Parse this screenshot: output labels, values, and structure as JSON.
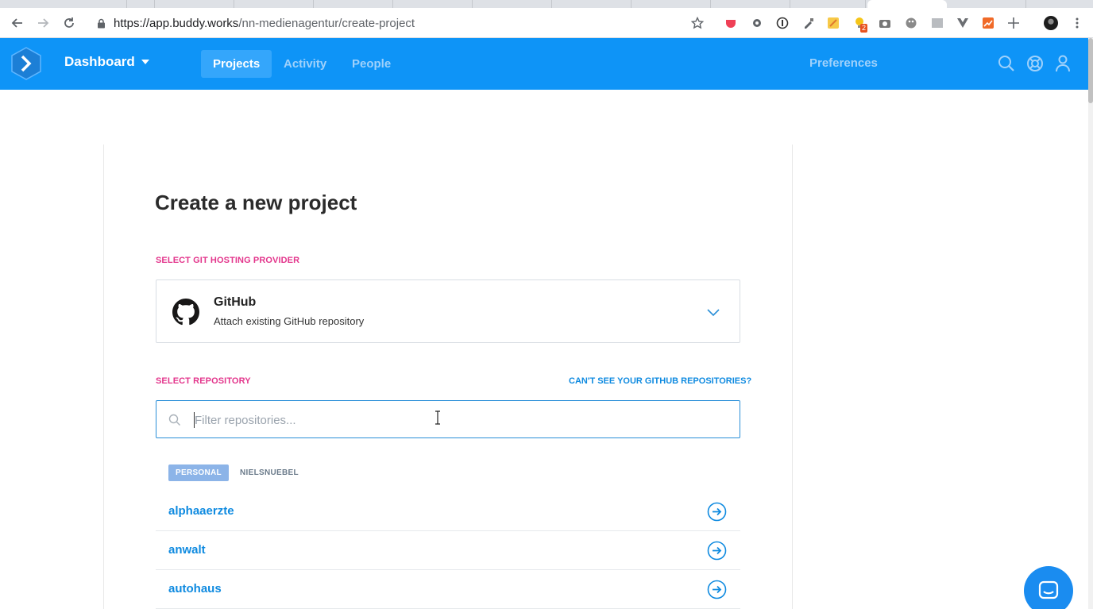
{
  "browser": {
    "url_host": "https://app.buddy.works",
    "url_path": "/nn-medienagentur/create-project",
    "extension_badge": "2"
  },
  "header": {
    "workspace_label": "Dashboard",
    "tabs": [
      {
        "label": "Projects",
        "active": true
      },
      {
        "label": "Activity",
        "active": false
      },
      {
        "label": "People",
        "active": false
      }
    ],
    "preferences_label": "Preferences",
    "colors": {
      "brand": "#0e94f7",
      "active_tab": "#34a6fb"
    }
  },
  "main": {
    "title": "Create a new project",
    "provider_section_label": "SELECT GIT HOSTING PROVIDER",
    "provider": {
      "name": "GitHub",
      "description": "Attach existing GitHub repository",
      "icon": "github-icon"
    },
    "repo_section_label": "SELECT REPOSITORY",
    "help_link": "CAN'T SEE YOUR GITHUB REPOSITORIES?",
    "filter": {
      "placeholder": "Filter repositories...",
      "value": ""
    },
    "owner_tabs": [
      {
        "label": "PERSONAL",
        "active": true
      },
      {
        "label": "NIELSNUEBEL",
        "active": false
      }
    ],
    "repositories": [
      "alphaaerzte",
      "anwalt",
      "autohaus"
    ],
    "colors": {
      "section_label": "#e3368c",
      "link": "#0e8ae0"
    }
  }
}
